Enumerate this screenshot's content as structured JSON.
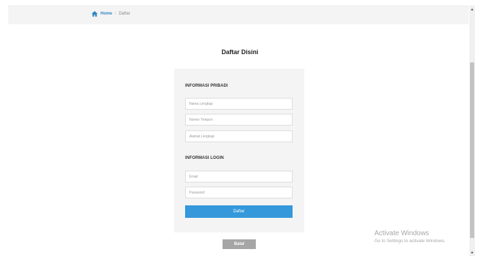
{
  "breadcrumb": {
    "home_label": "Home",
    "separator": "/",
    "current": "Daftar",
    "home_icon": "home-icon"
  },
  "page": {
    "title": "Daftar Disini"
  },
  "form": {
    "personal_section_label": "INFORMASI PRIBADI",
    "fields": {
      "full_name": {
        "placeholder": "Nama Lengkap",
        "value": ""
      },
      "phone": {
        "placeholder": "Nomor Telepon",
        "value": ""
      },
      "address": {
        "placeholder": "Alamat Lengkap",
        "value": ""
      },
      "email": {
        "placeholder": "Email",
        "value": ""
      },
      "password": {
        "placeholder": "Password",
        "value": ""
      }
    },
    "login_section_label": "INFORMASI LOGIN",
    "submit_label": "Daftar",
    "cancel_label": "Batal"
  },
  "windows_watermark": {
    "title": "Activate Windows",
    "subtitle": "Go to Settings to activate Windows."
  },
  "colors": {
    "accent": "#3498db",
    "link": "#2e86c1",
    "card_bg": "#f4f4f5",
    "cancel_bg": "#a6a6a6"
  }
}
